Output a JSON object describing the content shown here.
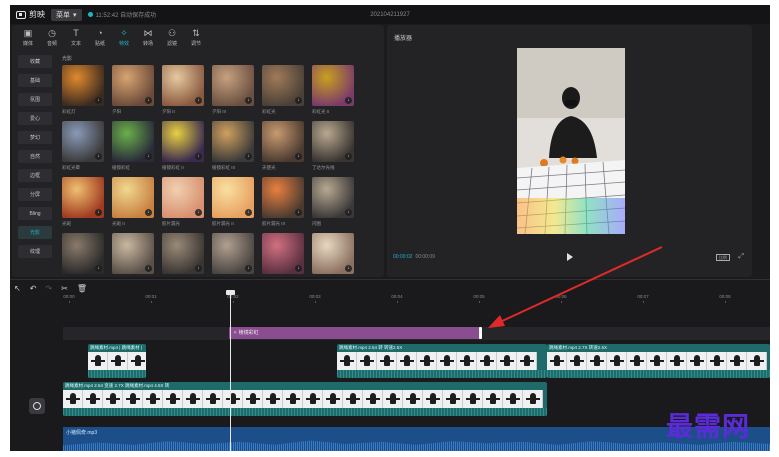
{
  "titlebar": {
    "app_name": "剪映",
    "menu_label": "菜单",
    "save_status": "11:52:42 自动保存成功",
    "project_title": "202104211927"
  },
  "toolbar": {
    "tools": [
      {
        "label": "媒体",
        "icon": "media-icon"
      },
      {
        "label": "音频",
        "icon": "audio-icon"
      },
      {
        "label": "文本",
        "icon": "text-icon"
      },
      {
        "label": "贴纸",
        "icon": "sticker-icon"
      },
      {
        "label": "特效",
        "icon": "effects-icon"
      },
      {
        "label": "转场",
        "icon": "transition-icon"
      },
      {
        "label": "滤镜",
        "icon": "filter-icon"
      },
      {
        "label": "调节",
        "icon": "adjust-icon"
      }
    ],
    "active_index": 4
  },
  "categories": [
    "收藏",
    "基础",
    "氛围",
    "爱心",
    "梦幻",
    "自然",
    "边框",
    "分屏",
    "Bling",
    "光影",
    "纹理"
  ],
  "active_category_index": 9,
  "section_label": "光影",
  "effects": [
    {
      "label": "彩虹灯",
      "color_a": "#e08a2e",
      "color_b": "#3b2a20"
    },
    {
      "label": "夕阳",
      "color_a": "#d8a470",
      "color_b": "#6b4a3a"
    },
    {
      "label": "夕阳 II",
      "color_a": "#e6c9a0",
      "color_b": "#8a5a40"
    },
    {
      "label": "夕阳 III",
      "color_a": "#c7a080",
      "color_b": "#6a5040"
    },
    {
      "label": "彩虹光",
      "color_a": "#a07a58",
      "color_b": "#4a4038"
    },
    {
      "label": "彩虹光 II",
      "color_a": "#c8a020",
      "color_b": "#7a3a6a"
    },
    {
      "label": "彩虹光晕",
      "color_a": "#8a9ab8",
      "color_b": "#3a3a3a"
    },
    {
      "label": "棱镜彩虹",
      "color_a": "#6ab04a",
      "color_b": "#2a2a3a"
    },
    {
      "label": "棱镜彩虹 II",
      "color_a": "#e8d040",
      "color_b": "#3a2a50"
    },
    {
      "label": "棱镜彩虹 III",
      "color_a": "#d0a060",
      "color_b": "#3a3a38"
    },
    {
      "label": "天使光",
      "color_a": "#c89a70",
      "color_b": "#4a3a30"
    },
    {
      "label": "丁达尔光线",
      "color_a": "#b8a890",
      "color_b": "#3a3530"
    },
    {
      "label": "光斑",
      "color_a": "#f0c070",
      "color_b": "#a03a20"
    },
    {
      "label": "光斑 II",
      "color_a": "#f0d890",
      "color_b": "#c88040"
    },
    {
      "label": "胶片漏光",
      "color_a": "#f0d0b0",
      "color_b": "#d89070"
    },
    {
      "label": "胶片漏光 II",
      "color_a": "#f8e0a0",
      "color_b": "#e8a060"
    },
    {
      "label": "胶片漏光 III",
      "color_a": "#e88040",
      "color_b": "#4a3a30"
    },
    {
      "label": "闪图",
      "color_a": "#b8a890",
      "color_b": "#3a3838"
    },
    {
      "label": "",
      "color_a": "#8a7a6a",
      "color_b": "#2a2a2a"
    },
    {
      "label": "",
      "color_a": "#c8b8a0",
      "color_b": "#5a5048"
    },
    {
      "label": "",
      "color_a": "#9a8a78",
      "color_b": "#3a3532"
    },
    {
      "label": "",
      "color_a": "#b0a090",
      "color_b": "#4a4440"
    },
    {
      "label": "",
      "color_a": "#d07080",
      "color_b": "#5a3040"
    },
    {
      "label": "",
      "color_a": "#e8d8c0",
      "color_b": "#8a7060"
    }
  ],
  "player": {
    "title": "播放器",
    "current_time": "00:00:02",
    "total_time": "00:00:09",
    "ratio_label": "比例"
  },
  "timeline": {
    "ruler_labels": [
      "00:00",
      "00:01",
      "00:02",
      "00:03",
      "00:04",
      "00:05",
      "00:06",
      "00:07",
      "00:08"
    ],
    "effect_clip_label": "棱镜彩虹",
    "clips_top": [
      {
        "head": "跳绳素材.mp4 | 跳绳素材 |",
        "frames": 3
      },
      {
        "head": "跳绳素材.mp4  2.54  转 转速2.5X",
        "frames": 10
      },
      {
        "head": "跳绳素材.mp4  2.7X  转速2.5X",
        "frames": 11
      }
    ],
    "main_clip_head": "跳绳素材.mp4  2.54  变速  2.7X  跳绳素材.mp4  4.5X  转",
    "main_frames": 24,
    "audio_label": "小猪佩奇.mp3"
  },
  "watermark": "最需网"
}
